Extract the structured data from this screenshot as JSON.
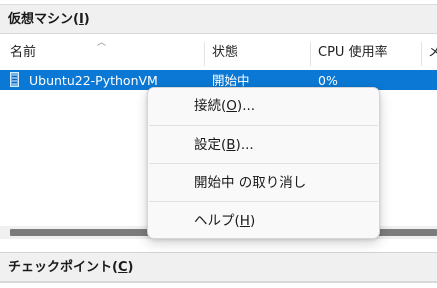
{
  "vm_pane": {
    "title": "仮想マシン(",
    "title_key": "I",
    "title_end": ")"
  },
  "columns": {
    "name": "名前",
    "state": "状態",
    "cpu": "CPU 使用率",
    "more": "メ"
  },
  "rows": [
    {
      "name": "Ubuntu22-PythonVM",
      "state": "開始中",
      "cpu": "0%",
      "selected": true
    }
  ],
  "context_menu": {
    "items": [
      {
        "text": "接続(",
        "key": "O",
        "suffix": ")..."
      },
      {
        "text": "設定(",
        "key": "B",
        "suffix": ")..."
      },
      {
        "text": "開始中 の取り消し",
        "key": "",
        "suffix": ""
      },
      {
        "text": "ヘルプ(",
        "key": "H",
        "suffix": ")"
      }
    ]
  },
  "checkpoint_pane": {
    "title": "チェックポイント(",
    "title_key": "C",
    "title_end": ")"
  },
  "colors": {
    "selection": "#0a78d4",
    "header_bg": "#f0f0f0",
    "menu_bg": "#f9f9f9"
  },
  "icons": {
    "vm": "vm-icon",
    "sort": "sort-up-icon"
  }
}
